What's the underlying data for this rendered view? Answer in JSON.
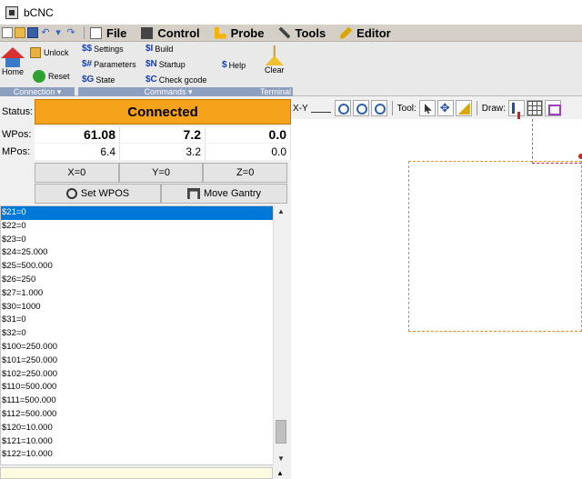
{
  "window": {
    "title": "bCNC"
  },
  "menu": {
    "file": "File",
    "control": "Control",
    "probe": "Probe",
    "tools": "Tools",
    "editor": "Editor"
  },
  "ribbon": {
    "connection": {
      "label": "Connection",
      "home": "Home",
      "unlock": "Unlock",
      "reset": "Reset"
    },
    "commands": {
      "label": "Commands",
      "settings": "Settings",
      "parameters": "Parameters",
      "state": "State",
      "build": "Build",
      "startup": "Startup",
      "check_gcode": "Check gcode",
      "help": "Help"
    },
    "terminal": {
      "label": "Terminal",
      "clear": "Clear"
    }
  },
  "status": {
    "label": "Status:",
    "value": "Connected",
    "color": "#f5a31a"
  },
  "wpos": {
    "label": "WPos:",
    "x": "61.08",
    "y": "7.2",
    "z": "0.0"
  },
  "mpos": {
    "label": "MPos:",
    "x": "6.4",
    "y": "3.2",
    "z": "0.0"
  },
  "zero_buttons": {
    "x": "X=0",
    "y": "Y=0",
    "z": "Z=0"
  },
  "actions": {
    "set_wpos": "Set WPOS",
    "move_gantry": "Move Gantry"
  },
  "terminal_lines": [
    "$21=0",
    "$22=0",
    "$23=0",
    "$24=25.000",
    "$25=500.000",
    "$26=250",
    "$27=1.000",
    "$30=1000",
    "$31=0",
    "$32=0",
    "$100=250.000",
    "$101=250.000",
    "$102=250.000",
    "$110=500.000",
    "$111=500.000",
    "$112=500.000",
    "$120=10.000",
    "$121=10.000",
    "$122=10.000"
  ],
  "terminal_selected_index": 0,
  "canvas_toolbar": {
    "view": "X-Y",
    "tool_label": "Tool:",
    "draw_label": "Draw:"
  }
}
